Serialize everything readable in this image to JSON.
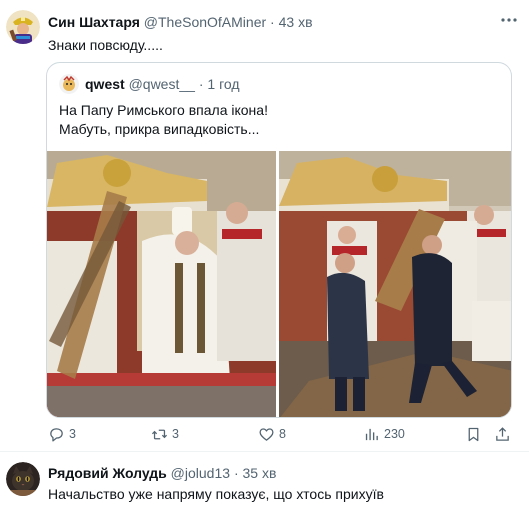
{
  "tweet": {
    "author_name": "Син Шахтаря",
    "author_handle": "@TheSonOfAMiner",
    "separator": "·",
    "time": "43 хв",
    "text": "Знаки повсюду.....",
    "more_icon": "more-horizontal-icon",
    "quote": {
      "author_name": "qwest",
      "author_handle": "@qwest__",
      "separator": "·",
      "time": "1 год",
      "text_line1": "На Папу Римського впала ікона!",
      "text_line2": "Мабуть, прикра випадковість...",
      "media_description_icon": "photo-collage"
    },
    "actions": {
      "reply_count": "3",
      "retweet_count": "3",
      "like_count": "8",
      "view_count": "230"
    }
  },
  "reply_tweet": {
    "author_name": "Рядовий Жолудь",
    "author_handle": "@jolud13",
    "separator": "·",
    "time": "35 хв",
    "text": "Начальство уже напряму показує, що хтось прихуїв"
  },
  "colors": {
    "text": "#0f1419",
    "muted": "#536471",
    "border": "#cfd9de",
    "accent": "#1d9bf0"
  }
}
